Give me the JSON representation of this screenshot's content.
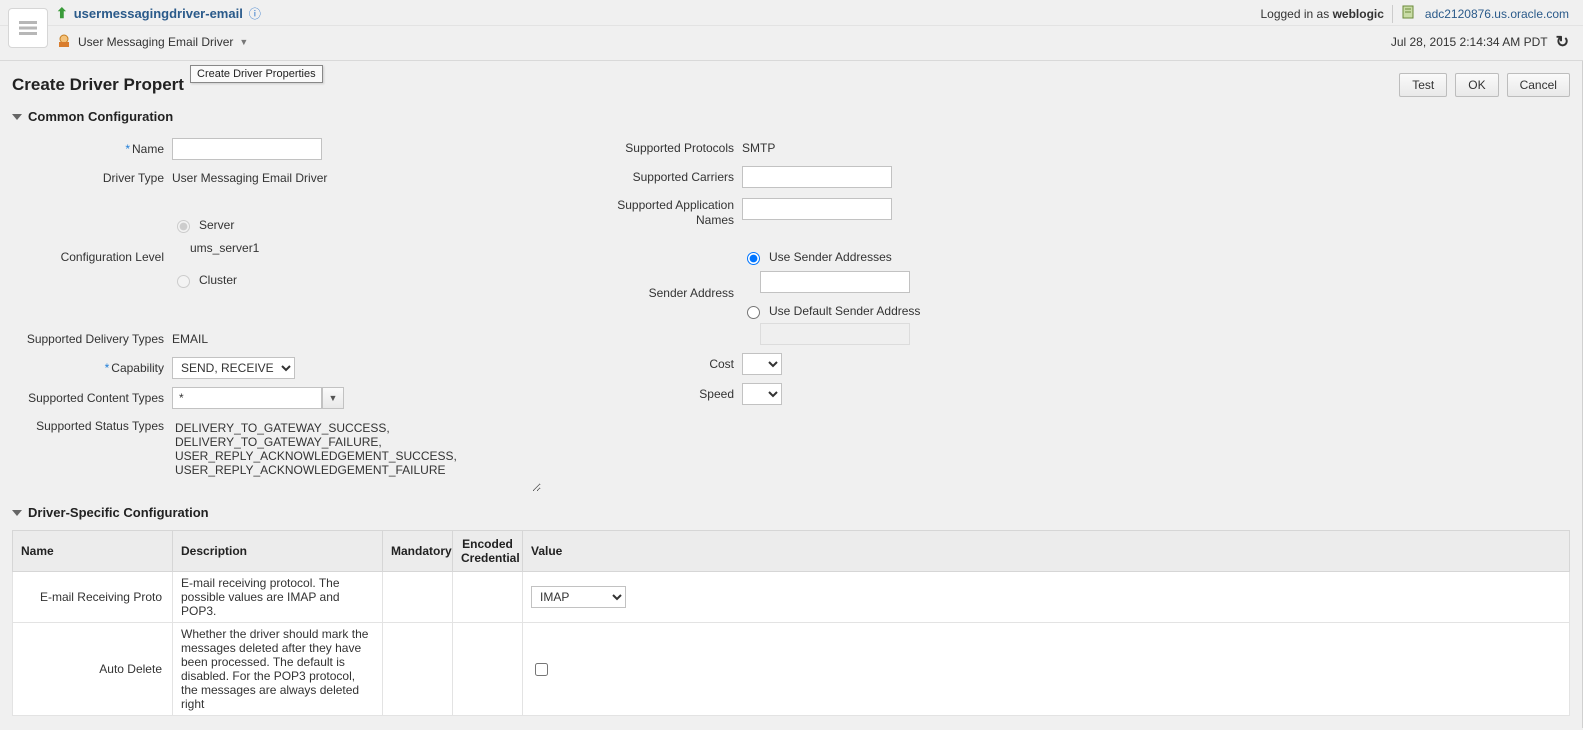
{
  "header": {
    "app_title": "usermessagingdriver-email",
    "subheader_label": "User Messaging Email Driver",
    "logged_in_prefix": "Logged in as",
    "logged_in_user": "weblogic",
    "host": "adc2120876.us.oracle.com",
    "timestamp": "Jul 28, 2015 2:14:34 AM PDT"
  },
  "page": {
    "title": "Create Driver Propert",
    "tooltip": "Create Driver Properties",
    "test_btn": "Test",
    "ok_btn": "OK",
    "cancel_btn": "Cancel"
  },
  "sections": {
    "common": "Common Configuration",
    "driver": "Driver-Specific Configuration"
  },
  "left": {
    "name_label": "Name",
    "name_value": "",
    "driver_type_label": "Driver Type",
    "driver_type_value": "User Messaging Email Driver",
    "config_level_label": "Configuration Level",
    "server_label": "Server",
    "server_value": "ums_server1",
    "cluster_label": "Cluster",
    "delivery_types_label": "Supported Delivery Types",
    "delivery_types_value": "EMAIL",
    "capability_label": "Capability",
    "capability_value": "SEND, RECEIVE",
    "content_types_label": "Supported Content Types",
    "content_types_value": "*",
    "status_types_label": "Supported Status Types",
    "status_types_value": "DELIVERY_TO_GATEWAY_SUCCESS,\nDELIVERY_TO_GATEWAY_FAILURE,\nUSER_REPLY_ACKNOWLEDGEMENT_SUCCESS,\nUSER_REPLY_ACKNOWLEDGEMENT_FAILURE"
  },
  "right": {
    "protocols_label": "Supported Protocols",
    "protocols_value": "SMTP",
    "carriers_label": "Supported Carriers",
    "carriers_value": "",
    "app_names_label": "Supported Application Names",
    "app_names_value": "",
    "sender_label": "Sender Address",
    "use_sender_label": "Use Sender Addresses",
    "sender_value": "",
    "use_default_label": "Use Default Sender Address",
    "cost_label": "Cost",
    "cost_value": "",
    "speed_label": "Speed",
    "speed_value": ""
  },
  "table": {
    "headers": {
      "name": "Name",
      "desc": "Description",
      "mandatory": "Mandatory",
      "encoded": "Encoded Credential",
      "value": "Value"
    },
    "rows": [
      {
        "name": "E-mail Receiving Proto",
        "desc": "E-mail receiving protocol. The possible values are IMAP and POP3.",
        "value_select": "IMAP"
      },
      {
        "name": "Auto Delete",
        "desc": "Whether the driver should mark the messages deleted after they have been processed. The default is disabled. For the POP3 protocol, the messages are always deleted right",
        "value_checkbox": false
      }
    ]
  }
}
